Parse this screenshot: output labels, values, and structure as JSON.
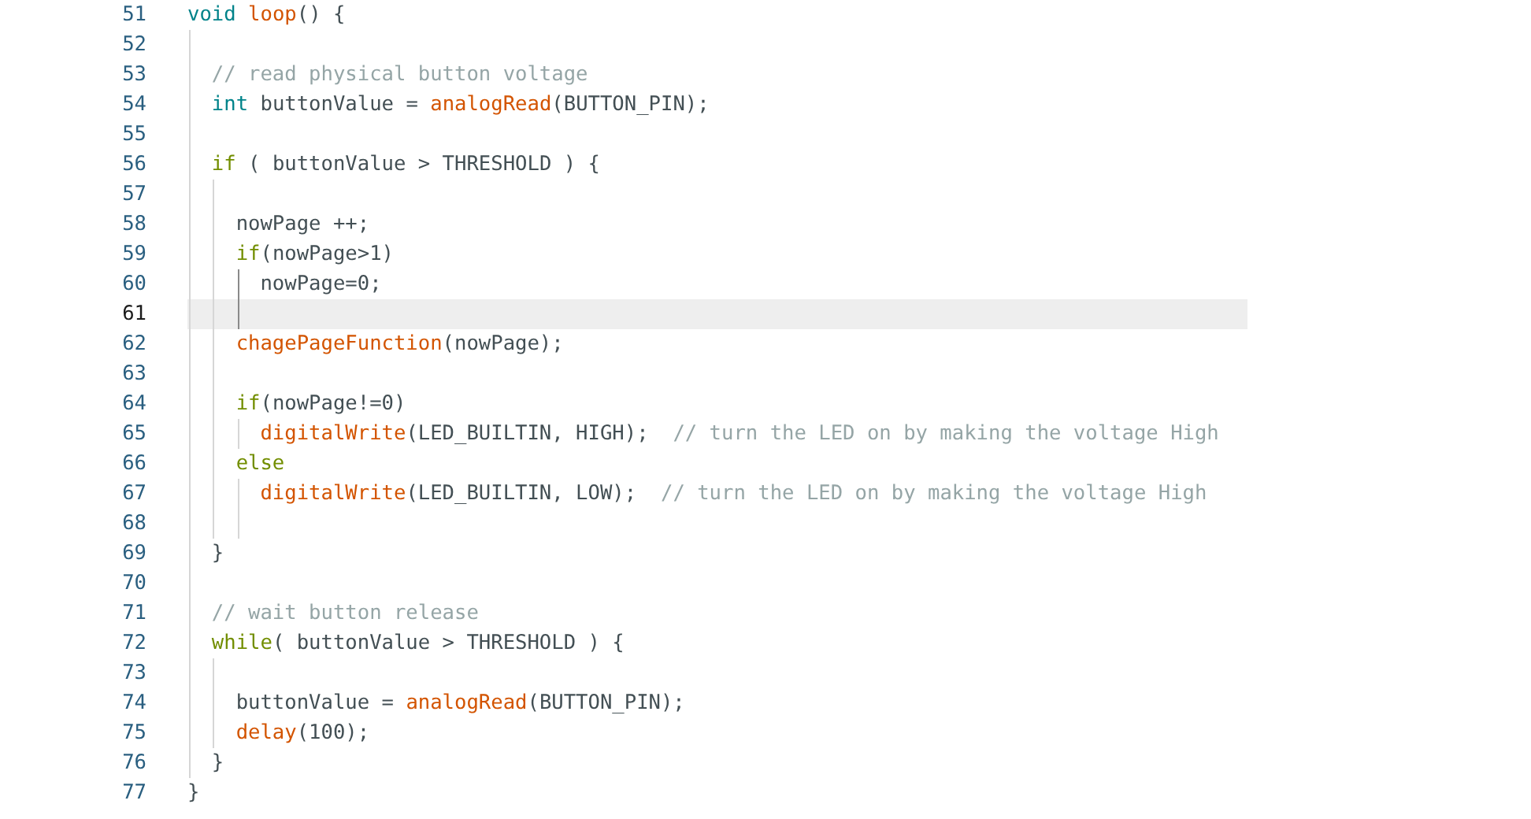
{
  "editor": {
    "lines": [
      {
        "number": "51",
        "current": false,
        "tokens": [
          {
            "kind": "type",
            "text": "void"
          },
          {
            "kind": "function",
            "text": " loop"
          },
          {
            "kind": "plain",
            "text": "() {"
          }
        ]
      },
      {
        "number": "52",
        "current": false
      },
      {
        "number": "53",
        "current": false,
        "tokens": [
          {
            "kind": "comment",
            "text": "  // read physical button voltage"
          }
        ]
      },
      {
        "number": "54",
        "current": false,
        "tokens": [
          {
            "kind": "type",
            "text": "  int"
          },
          {
            "kind": "plain",
            "text": " buttonValue = "
          },
          {
            "kind": "function",
            "text": "analogRead"
          },
          {
            "kind": "plain",
            "text": "(BUTTON_PIN);"
          }
        ]
      },
      {
        "number": "55",
        "current": false
      },
      {
        "number": "56",
        "current": false,
        "tokens": [
          {
            "kind": "keyword",
            "text": "  if"
          },
          {
            "kind": "plain",
            "text": " ( buttonValue > THRESHOLD ) {"
          }
        ]
      },
      {
        "number": "57",
        "current": false
      },
      {
        "number": "58",
        "current": false,
        "tokens": [
          {
            "kind": "plain",
            "text": "    nowPage ++;"
          }
        ]
      },
      {
        "number": "59",
        "current": false,
        "tokens": [
          {
            "kind": "keyword",
            "text": "    if"
          },
          {
            "kind": "plain",
            "text": "(nowPage>1)"
          }
        ]
      },
      {
        "number": "60",
        "current": false,
        "tokens": [
          {
            "kind": "plain",
            "text": "      nowPage=0;"
          }
        ]
      },
      {
        "number": "61",
        "current": true
      },
      {
        "number": "62",
        "current": false,
        "tokens": [
          {
            "kind": "function",
            "text": "    chagePageFunction"
          },
          {
            "kind": "plain",
            "text": "(nowPage);"
          }
        ]
      },
      {
        "number": "63",
        "current": false
      },
      {
        "number": "64",
        "current": false,
        "tokens": [
          {
            "kind": "keyword",
            "text": "    if"
          },
          {
            "kind": "plain",
            "text": "(nowPage!=0)"
          }
        ]
      },
      {
        "number": "65",
        "current": false,
        "tokens": [
          {
            "kind": "function",
            "text": "      digitalWrite"
          },
          {
            "kind": "plain",
            "text": "(LED_BUILTIN, HIGH);"
          },
          {
            "kind": "comment",
            "text": "  // turn the LED on by making the voltage High"
          }
        ]
      },
      {
        "number": "66",
        "current": false,
        "tokens": [
          {
            "kind": "keyword",
            "text": "    else"
          }
        ]
      },
      {
        "number": "67",
        "current": false,
        "tokens": [
          {
            "kind": "function",
            "text": "      digitalWrite"
          },
          {
            "kind": "plain",
            "text": "(LED_BUILTIN, LOW);"
          },
          {
            "kind": "comment",
            "text": "  // turn the LED on by making the voltage High"
          }
        ]
      },
      {
        "number": "68",
        "current": false
      },
      {
        "number": "69",
        "current": false,
        "tokens": [
          {
            "kind": "plain",
            "text": "  }"
          }
        ]
      },
      {
        "number": "70",
        "current": false
      },
      {
        "number": "71",
        "current": false,
        "tokens": [
          {
            "kind": "comment",
            "text": "  // wait button release"
          }
        ]
      },
      {
        "number": "72",
        "current": false,
        "tokens": [
          {
            "kind": "keyword",
            "text": "  while"
          },
          {
            "kind": "plain",
            "text": "( buttonValue > THRESHOLD ) {"
          }
        ]
      },
      {
        "number": "73",
        "current": false
      },
      {
        "number": "74",
        "current": false,
        "tokens": [
          {
            "kind": "plain",
            "text": "    buttonValue = "
          },
          {
            "kind": "function",
            "text": "analogRead"
          },
          {
            "kind": "plain",
            "text": "(BUTTON_PIN);"
          }
        ]
      },
      {
        "number": "75",
        "current": false,
        "tokens": [
          {
            "kind": "function",
            "text": "    delay"
          },
          {
            "kind": "plain",
            "text": "(100);"
          }
        ]
      },
      {
        "number": "76",
        "current": false,
        "tokens": [
          {
            "kind": "plain",
            "text": "  }"
          }
        ]
      },
      {
        "number": "77",
        "current": false,
        "tokens": [
          {
            "kind": "plain",
            "text": "}"
          }
        ]
      }
    ]
  }
}
